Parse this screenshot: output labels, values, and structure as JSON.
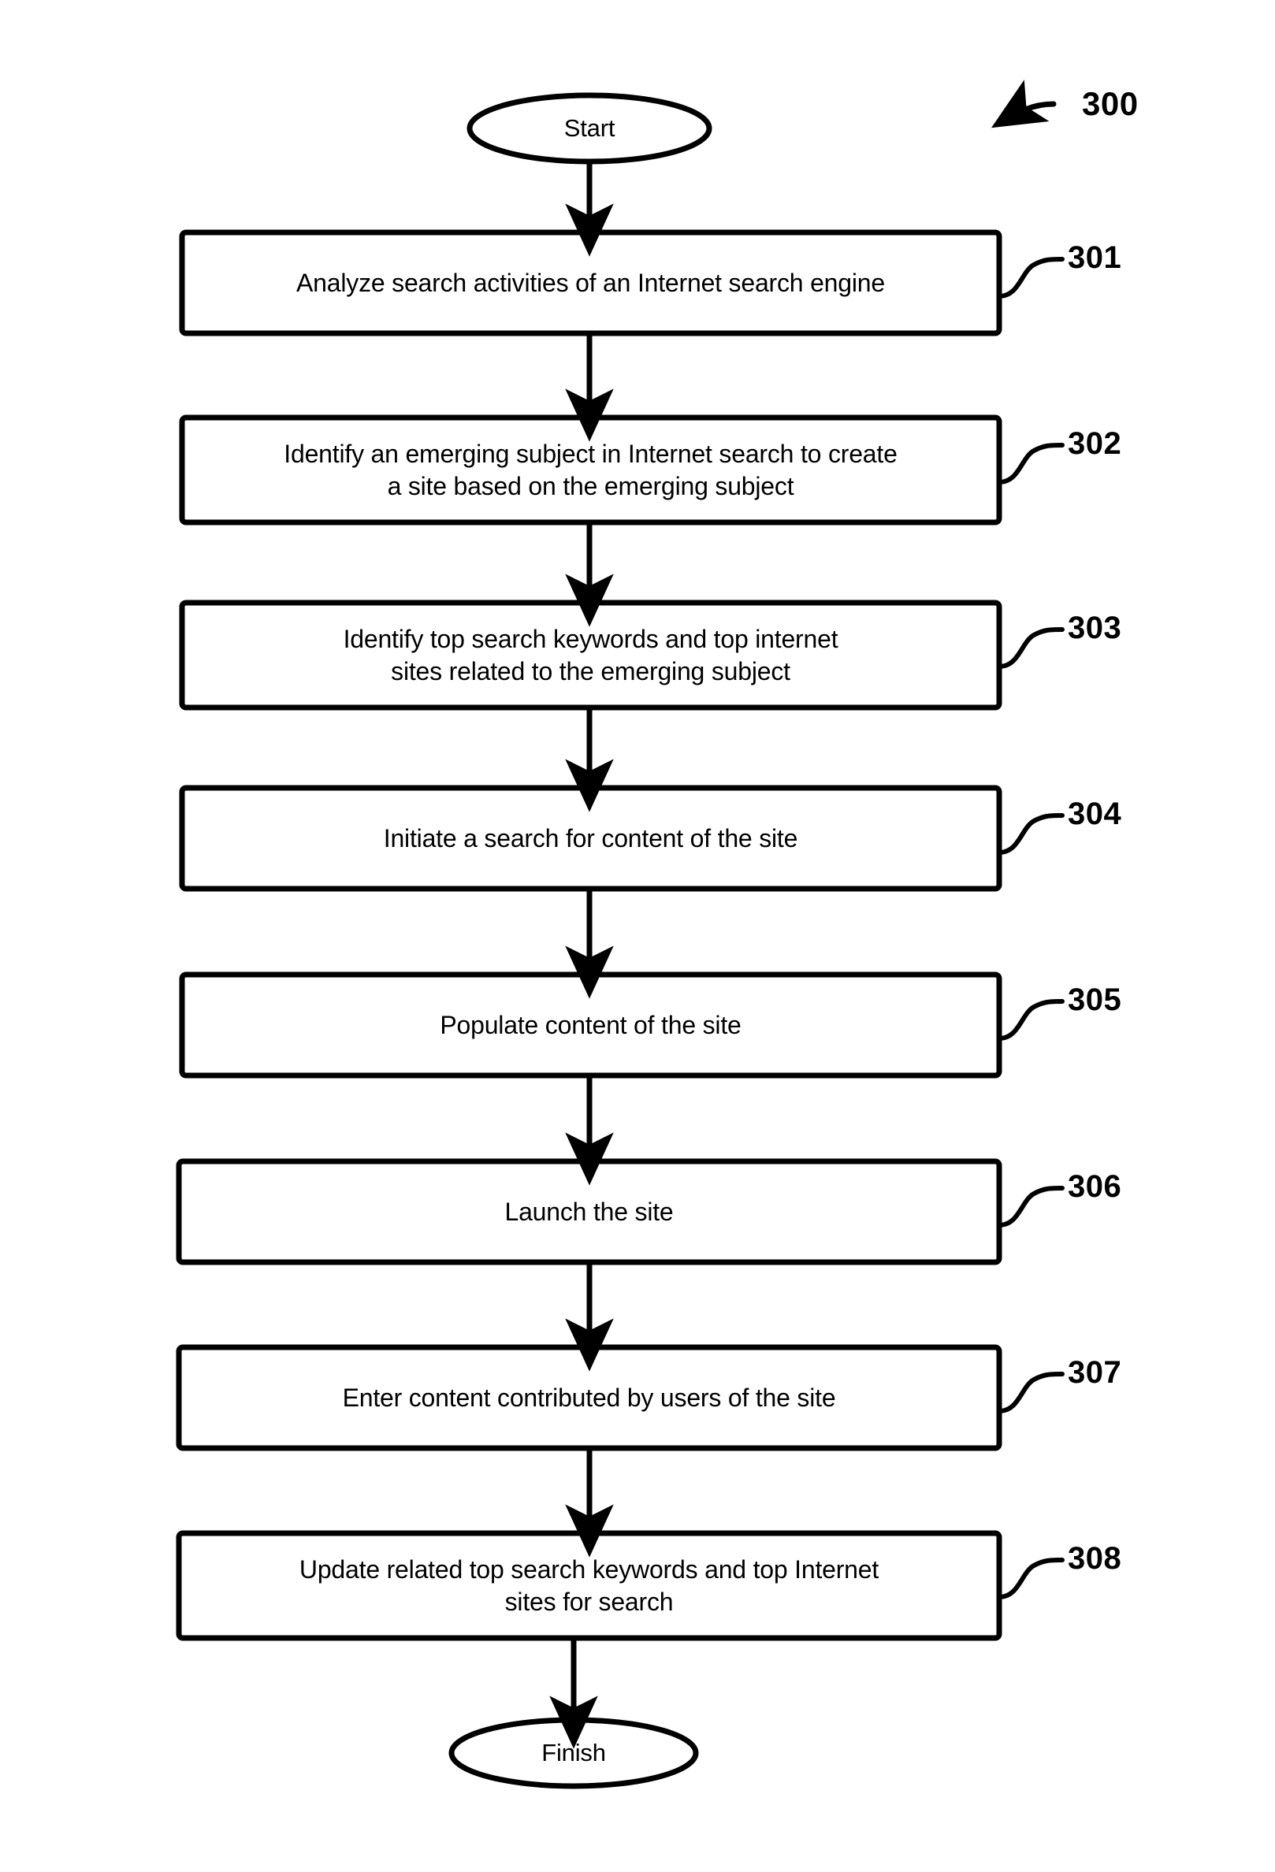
{
  "figure": {
    "reference_numeral": "300"
  },
  "flowchart": {
    "start": {
      "label": "Start",
      "shape": "ellipse"
    },
    "finish": {
      "label": "Finish",
      "shape": "ellipse"
    },
    "steps": [
      {
        "ref": "301",
        "text": "Analyze search activities of an Internet search engine",
        "lines": 1
      },
      {
        "ref": "302",
        "text": "Identify an emerging subject in Internet search to create\na site based on the emerging subject",
        "lines": 2
      },
      {
        "ref": "303",
        "text": "Identify top search keywords and top internet\nsites related to the emerging subject",
        "lines": 2
      },
      {
        "ref": "304",
        "text": "Initiate a search for content of the site",
        "lines": 1
      },
      {
        "ref": "305",
        "text": "Populate content of the site",
        "lines": 1
      },
      {
        "ref": "306",
        "text": "Launch the site",
        "lines": 1
      },
      {
        "ref": "307",
        "text": "Enter content contributed by users of the site",
        "lines": 1
      },
      {
        "ref": "308",
        "text": "Update related top search keywords and top Internet\nsites for search",
        "lines": 2
      }
    ]
  },
  "colors": {
    "stroke": "#000000",
    "background": "#ffffff"
  }
}
